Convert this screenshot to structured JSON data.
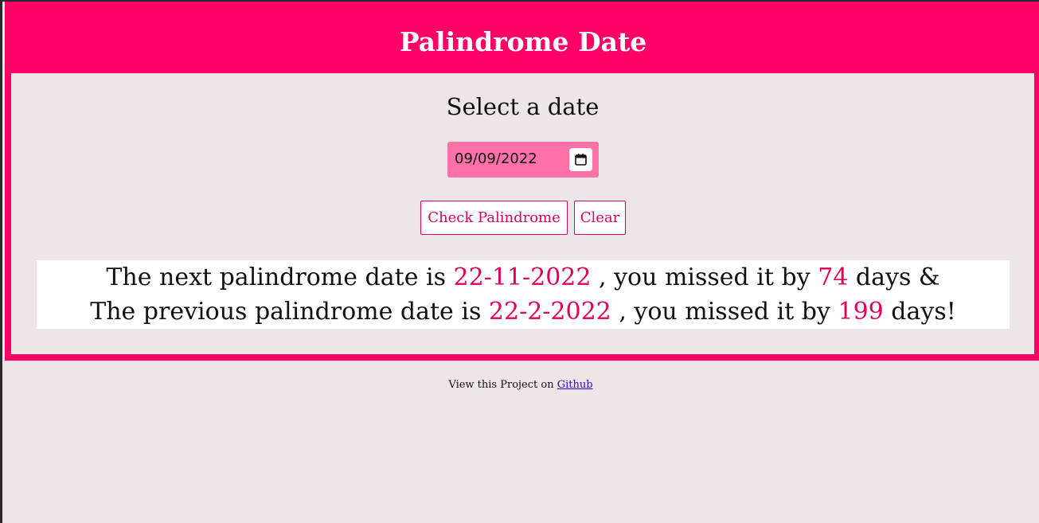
{
  "header": {
    "title": "Palindrome Date"
  },
  "form": {
    "select_label": "Select a date",
    "date_value": "09/09/2022",
    "check_button": "Check Palindrome",
    "clear_button": "Clear"
  },
  "result": {
    "line1_prefix": "The next palindrome date is",
    "next_date": "22-11-2022",
    "line1_middle": ", you missed it by",
    "next_days": "74",
    "line1_suffix": "days &",
    "line2_prefix": "The previous palindrome date is",
    "prev_date": "22-2-2022",
    "line2_middle": ", you missed it by",
    "prev_days": "199",
    "line2_suffix": "days!"
  },
  "footer": {
    "text": "View this Project on",
    "link_label": "Github"
  },
  "colors": {
    "brand": "#ff0066",
    "accent_text": "#e0005a",
    "date_input_bg": "#ff72a8",
    "panel_bg": "#ece6e9"
  },
  "icons": {
    "calendar": "calendar-icon"
  }
}
